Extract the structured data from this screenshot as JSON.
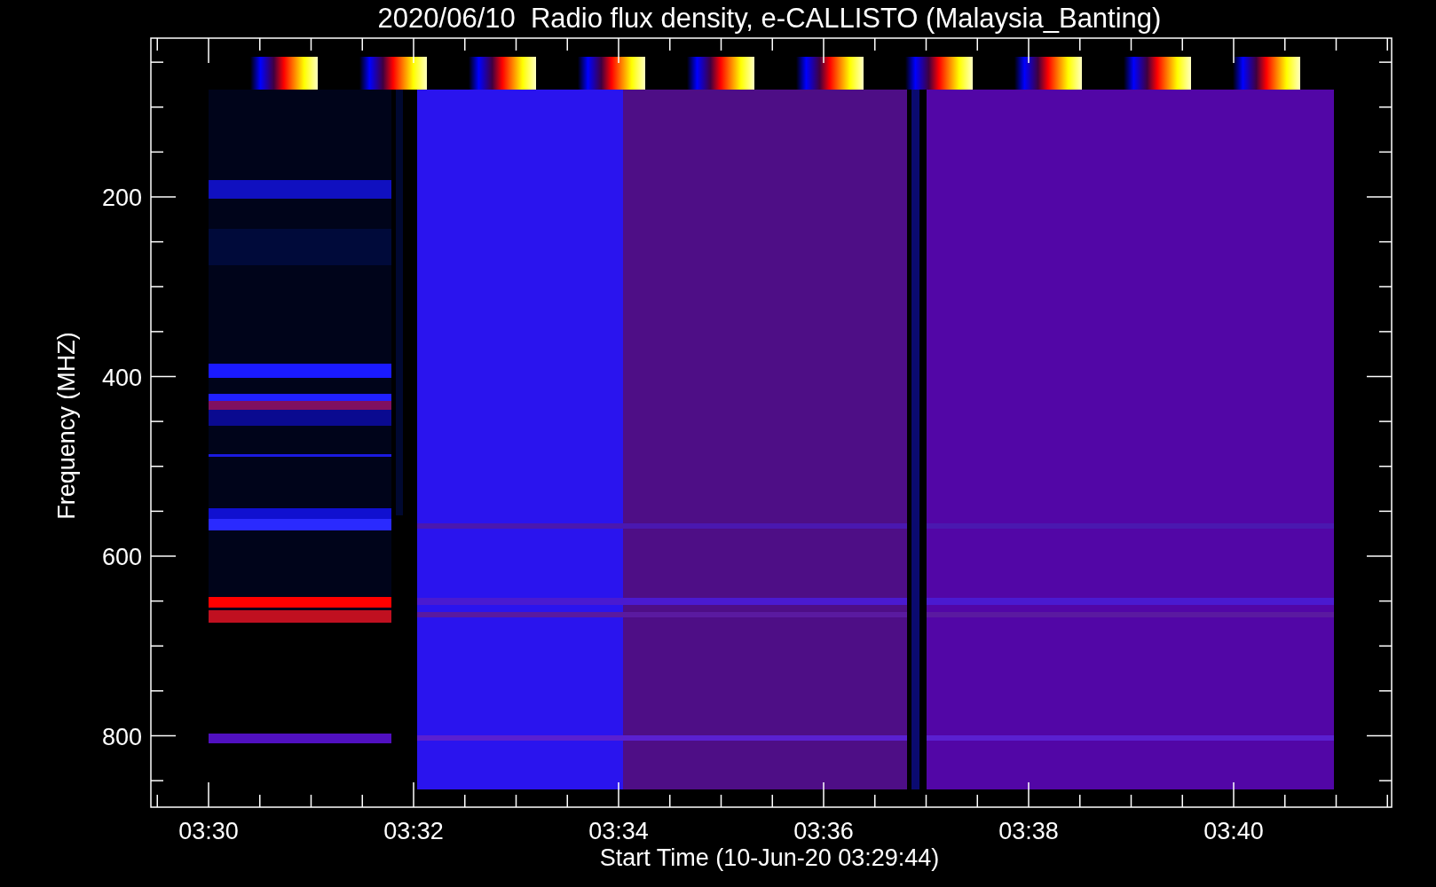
{
  "title": "2020/06/10  Radio flux density, e-CALLISTO (Malaysia_Banting)",
  "ylabel": "Frequency (MHZ)",
  "xlabel": "Start Time (10-Jun-20 03:29:44)",
  "yticks": [
    "200",
    "400",
    "600",
    "800"
  ],
  "xticks": [
    "03:30",
    "03:32",
    "03:34",
    "03:36",
    "03:38",
    "03:40"
  ]
}
